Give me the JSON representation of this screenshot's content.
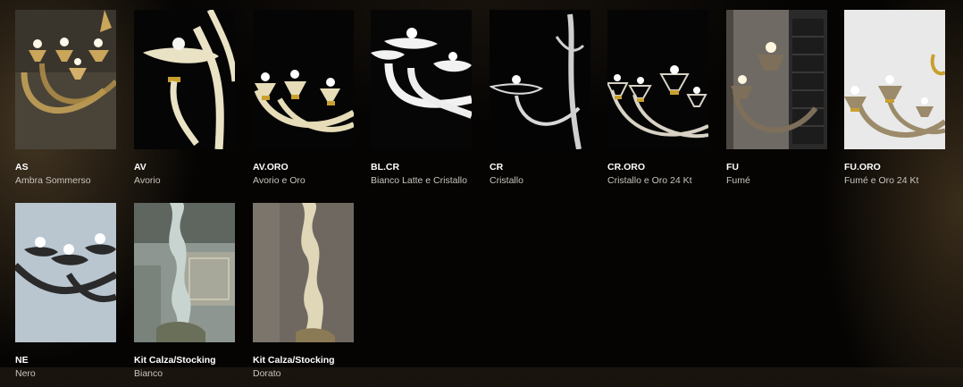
{
  "items": [
    {
      "code": "AS",
      "name": "Ambra Sommerso",
      "bg": "#2a2620",
      "glass": "#c9a65a",
      "gold": true,
      "image": "amber-chandelier-photo"
    },
    {
      "code": "AV",
      "name": "Avorio",
      "bg": "#050505",
      "glass": "#e9e2c4",
      "gold": true,
      "image": "ivory-chandelier-photo"
    },
    {
      "code": "AV.ORO",
      "name": "Avorio e Oro",
      "bg": "#050505",
      "glass": "#e6dcb8",
      "gold": true,
      "image": "ivory-gold-chandelier-photo"
    },
    {
      "code": "BL.CR",
      "name": "Bianco Latte e Cristallo",
      "bg": "#060606",
      "glass": "#f2f2f2",
      "gold": false,
      "image": "milk-white-chandelier-photo"
    },
    {
      "code": "CR",
      "name": "Cristallo",
      "bg": "#040404",
      "glass": "#d8d8d8",
      "gold": false,
      "image": "crystal-chandelier-photo"
    },
    {
      "code": "CR.ORO",
      "name": "Cristallo e Oro 24 Kt",
      "bg": "#050505",
      "glass": "#d7d2c4",
      "gold": true,
      "image": "crystal-gold-chandelier-photo"
    },
    {
      "code": "FU",
      "name": "Fumé",
      "bg": "#6f6a63",
      "glass": "#7d6f5a",
      "gold": false,
      "image": "smoke-chandelier-photo"
    },
    {
      "code": "FU.ORO",
      "name": "Fumé e Oro 24 Kt",
      "bg": "#e9e9e9",
      "glass": "#9c8b6a",
      "gold": true,
      "image": "smoke-gold-chandelier-photo"
    },
    {
      "code": "NE",
      "name": "Nero",
      "bg": "#b9c6cf",
      "glass": "#2a2a2a",
      "gold": false,
      "image": "black-chandelier-photo"
    },
    {
      "code": "Kit Calza/Stocking",
      "name": "Bianco",
      "bg": "#8d9690",
      "glass": "#c8d4cf",
      "gold": false,
      "image": "white-stocking-photo"
    },
    {
      "code": "Kit Calza/Stocking",
      "name": "Dorato",
      "bg": "#6f6860",
      "glass": "#e0d6b8",
      "gold": false,
      "image": "gold-stocking-photo"
    }
  ]
}
